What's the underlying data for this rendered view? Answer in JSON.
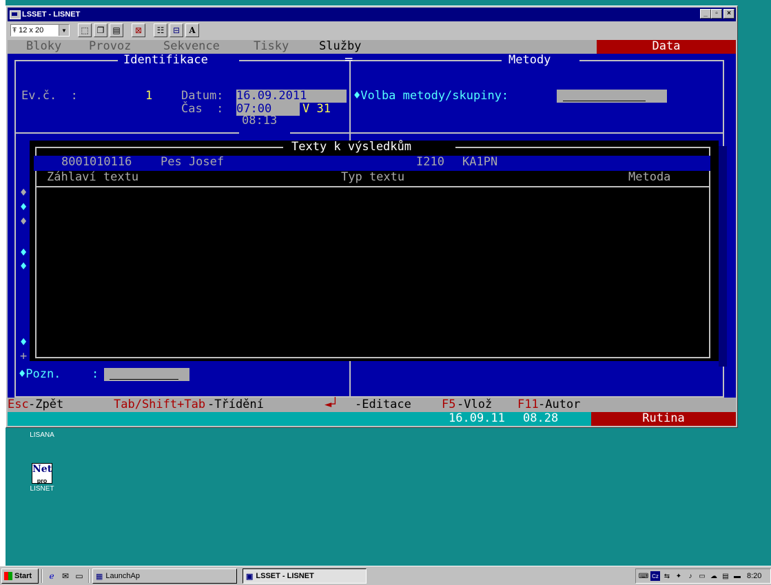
{
  "window": {
    "title": "LSSET - LISNET",
    "buttons": {
      "minimize": "_",
      "maximize": "▫",
      "close": "×"
    }
  },
  "toolbar": {
    "font_size": "12 x 20",
    "icons": [
      "mark-icon",
      "copy-icon",
      "paste-icon",
      "fullscreen-icon",
      "properties-icon",
      "background-icon",
      "font-icon"
    ],
    "font_btn": "A"
  },
  "menu": {
    "items": [
      "Bloky",
      "Provoz",
      "Sekvence",
      "Tisky",
      "Služby"
    ],
    "active": "Služby",
    "data_label": "Data"
  },
  "identifikace": {
    "header": "Identifikace",
    "evc_label": "Ev.č.  :",
    "evc_value": "1",
    "datum_label": "Datum:",
    "datum_value": "16.09.2011",
    "cas_label": "Čas  :",
    "cas_value": "07:00",
    "v_value": "V 31",
    "time2": "08:13"
  },
  "metody": {
    "header": "Metody",
    "volba_label": "♦Volba metody/skupiny:"
  },
  "popup": {
    "title": "Texty k výsledkům",
    "record_id": "8001010116",
    "record_name": "Pes Josef",
    "record_code": "I210",
    "record_method": "KA1PN",
    "columns": [
      "Záhlaví textu",
      "Typ textu",
      "Metoda"
    ]
  },
  "side_markers": [
    "♦",
    "♦",
    "♦",
    "♦",
    "♦",
    "♦",
    "+"
  ],
  "pozn": {
    "label": "♦Pozn.",
    "sep": ":"
  },
  "hints": [
    {
      "key": "Esc",
      "text": "-Zpět"
    },
    {
      "key": "Tab/Shift+Tab",
      "text": "-Třídění"
    },
    {
      "key": "◄┘",
      "text": "-Editace"
    },
    {
      "key": "F5",
      "text": "-Vlož"
    },
    {
      "key": "F11",
      "text": "-Autor"
    }
  ],
  "status": {
    "date": "16.09.11",
    "time": "08.28",
    "mode": "Rutina"
  },
  "desktop": {
    "icons": [
      {
        "label": "LISANA"
      },
      {
        "label": "LISNET",
        "pic_text": "Net",
        "pic_sub": "pro"
      }
    ]
  },
  "taskbar": {
    "start": "Start",
    "launch": "LaunchAp",
    "task": "LSSET - LISNET",
    "clock": "8:20"
  }
}
